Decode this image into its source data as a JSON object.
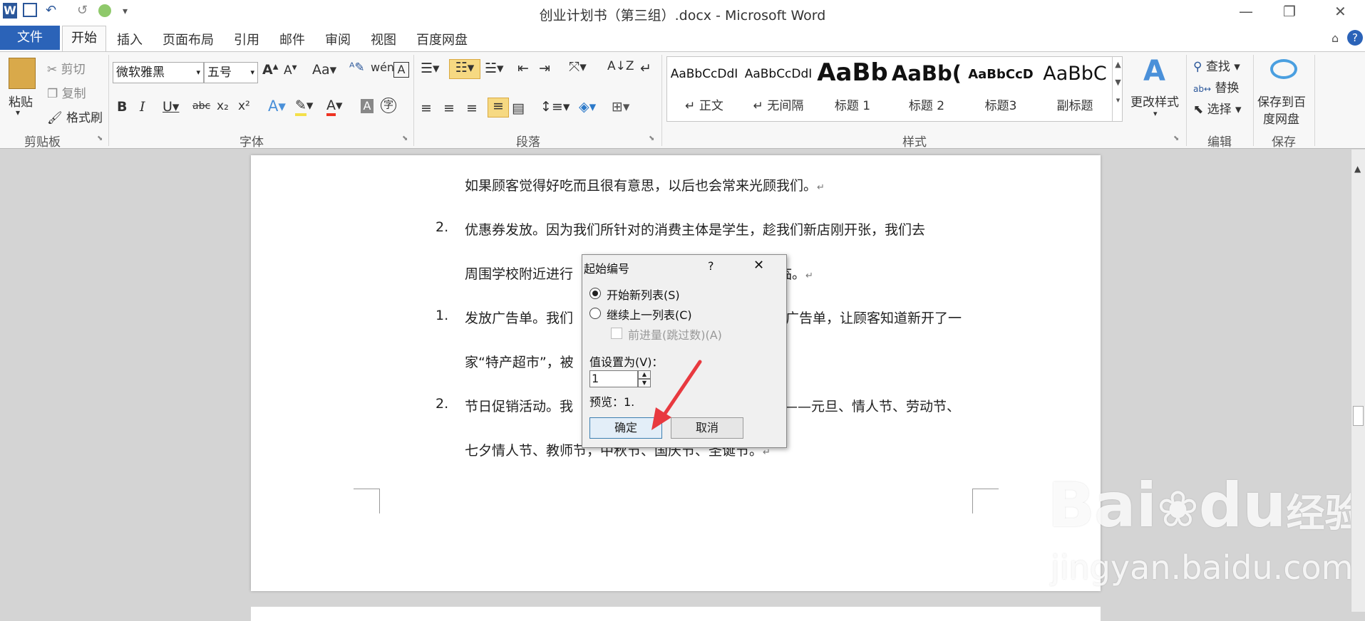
{
  "window": {
    "title": "创业计划书（第三组）.docx - Microsoft Word",
    "minimize_label": "—",
    "restore_label": "❐",
    "close_label": "✕",
    "help_label": "?"
  },
  "quick_access": {
    "undo": "↶",
    "redo": "↺",
    "customize": "▾"
  },
  "tabs": [
    "文件",
    "开始",
    "插入",
    "页面布局",
    "引用",
    "邮件",
    "审阅",
    "视图",
    "百度网盘"
  ],
  "ribbon": {
    "clipboard": {
      "paste": "粘贴",
      "cut": "剪切",
      "copy": "复制",
      "format_painter": "格式刷",
      "group": "剪贴板"
    },
    "font": {
      "name": "微软雅黑",
      "size": "五号",
      "group": "字体"
    },
    "paragraph": {
      "group": "段落"
    },
    "styles": {
      "items": [
        {
          "preview": "AaBbCcDdI",
          "name": "↵ 正文"
        },
        {
          "preview": "AaBbCcDdI",
          "name": "↵ 无间隔"
        },
        {
          "preview": "AaBb",
          "name": "标题 1"
        },
        {
          "preview": "AaBb(",
          "name": "标题 2"
        },
        {
          "preview": "AaBbCcD",
          "name": "标题3"
        },
        {
          "preview": "AaBbC",
          "name": "副标题"
        }
      ],
      "change_styles": "更改样式",
      "group": "样式"
    },
    "editing": {
      "find": "查找",
      "replace": "替换",
      "select": "选择",
      "group": "编辑"
    },
    "save": {
      "label_line1": "保存到百",
      "label_line2": "度网盘",
      "group": "保存"
    }
  },
  "document": {
    "lines": [
      {
        "num": "",
        "text": "如果顾客觉得好吃而且很有意思，以后也会常来光顾我们。"
      },
      {
        "num": "2.",
        "text": "优惠券发放。因为我们所针对的消费主体是学生，趁我们新店刚开张，我们去"
      },
      {
        "num": "",
        "text": "周围学校附近进行"
      },
      {
        "num": "",
        "text": "临。"
      },
      {
        "num": "1.",
        "text": "发放广告单。我们"
      },
      {
        "num": "",
        "text": "广告单，让顾客知道新开了一"
      },
      {
        "num": "",
        "text": "家“特产超市”，被"
      },
      {
        "num": "2.",
        "text": "节日促销活动。我"
      },
      {
        "num": "",
        "text": "——元旦、情人节、劳动节、"
      },
      {
        "num": "",
        "text": "七夕情人节、教师节，中秋节、国庆节、圣诞节。"
      }
    ],
    "paragraph_mark": "↵"
  },
  "dialog": {
    "title": "起始编号",
    "help": "?",
    "close": "✕",
    "option_new": "开始新列表(S)",
    "option_continue": "继续上一列表(C)",
    "option_advance": "前进量(跳过数)(A)",
    "value_label": "值设置为(V)：",
    "value": "1",
    "preview": "预览：1.",
    "ok": "确定",
    "cancel": "取消"
  },
  "watermark": {
    "brand": "Bai",
    "brand2": "du",
    "jingyan": "经验",
    "url": "jingyan.baidu.com"
  },
  "colors": {
    "file_tab": "#2b63b8",
    "arrow": "#e8393f",
    "highlight": "#f6c94c"
  }
}
